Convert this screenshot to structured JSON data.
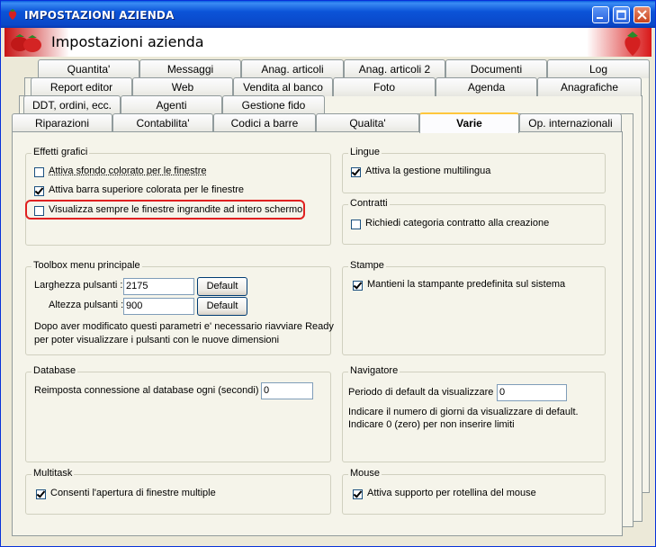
{
  "window": {
    "title": "IMPOSTAZIONI AZIENDA"
  },
  "banner": {
    "title": "Impostazioni azienda"
  },
  "tabs": {
    "row1": [
      "Quantita'",
      "Messaggi",
      "Anag. articoli",
      "Anag. articoli 2",
      "Documenti",
      "Log"
    ],
    "row2": [
      "Report editor",
      "Web",
      "Vendita al banco",
      "Foto",
      "Agenda",
      "Anagrafiche"
    ],
    "row3": [
      "DDT, ordini, ecc.",
      "Agenti",
      "Gestione fido"
    ],
    "row4": [
      "Riparazioni",
      "Contabilita'",
      "Codici a barre",
      "Qualita'",
      "Varie",
      "Op. internazionali"
    ],
    "active": "Varie"
  },
  "effetti": {
    "legend": "Effetti grafici",
    "opt1": "Attiva sfondo colorato per le finestre",
    "opt1_checked": false,
    "opt2": "Attiva barra superiore colorata per le finestre",
    "opt2_checked": true,
    "opt3": "Visualizza sempre le finestre ingrandite ad intero schermo",
    "opt3_checked": false
  },
  "lingue": {
    "legend": "Lingue",
    "opt1": "Attiva la gestione multilingua",
    "opt1_checked": true
  },
  "contratti": {
    "legend": "Contratti",
    "opt1": "Richiedi categoria contratto alla creazione",
    "opt1_checked": false
  },
  "toolbox": {
    "legend": "Toolbox menu principale",
    "width_label": "Larghezza pulsanti :",
    "width_value": "2175",
    "height_label": "Altezza pulsanti :",
    "height_value": "900",
    "default_label": "Default",
    "note1": "Dopo aver modificato questi parametri e' necessario riavviare Ready",
    "note2": "per poter visualizzare i pulsanti con le nuove dimensioni"
  },
  "stampe": {
    "legend": "Stampe",
    "opt1": "Mantieni la stampante predefinita sul sistema",
    "opt1_checked": true
  },
  "database": {
    "legend": "Database",
    "label": "Reimposta connessione al database ogni (secondi) :",
    "value": "0"
  },
  "navigatore": {
    "legend": "Navigatore",
    "label": "Periodo di default da visualizzare :",
    "value": "0",
    "note1": "Indicare il numero di giorni da visualizzare di default.",
    "note2": "Indicare 0 (zero) per non inserire limiti"
  },
  "multitask": {
    "legend": "Multitask",
    "opt1": "Consenti l'apertura di finestre multiple",
    "opt1_checked": true
  },
  "mouse": {
    "legend": "Mouse",
    "opt1": "Attiva supporto per rotellina del mouse",
    "opt1_checked": true
  }
}
